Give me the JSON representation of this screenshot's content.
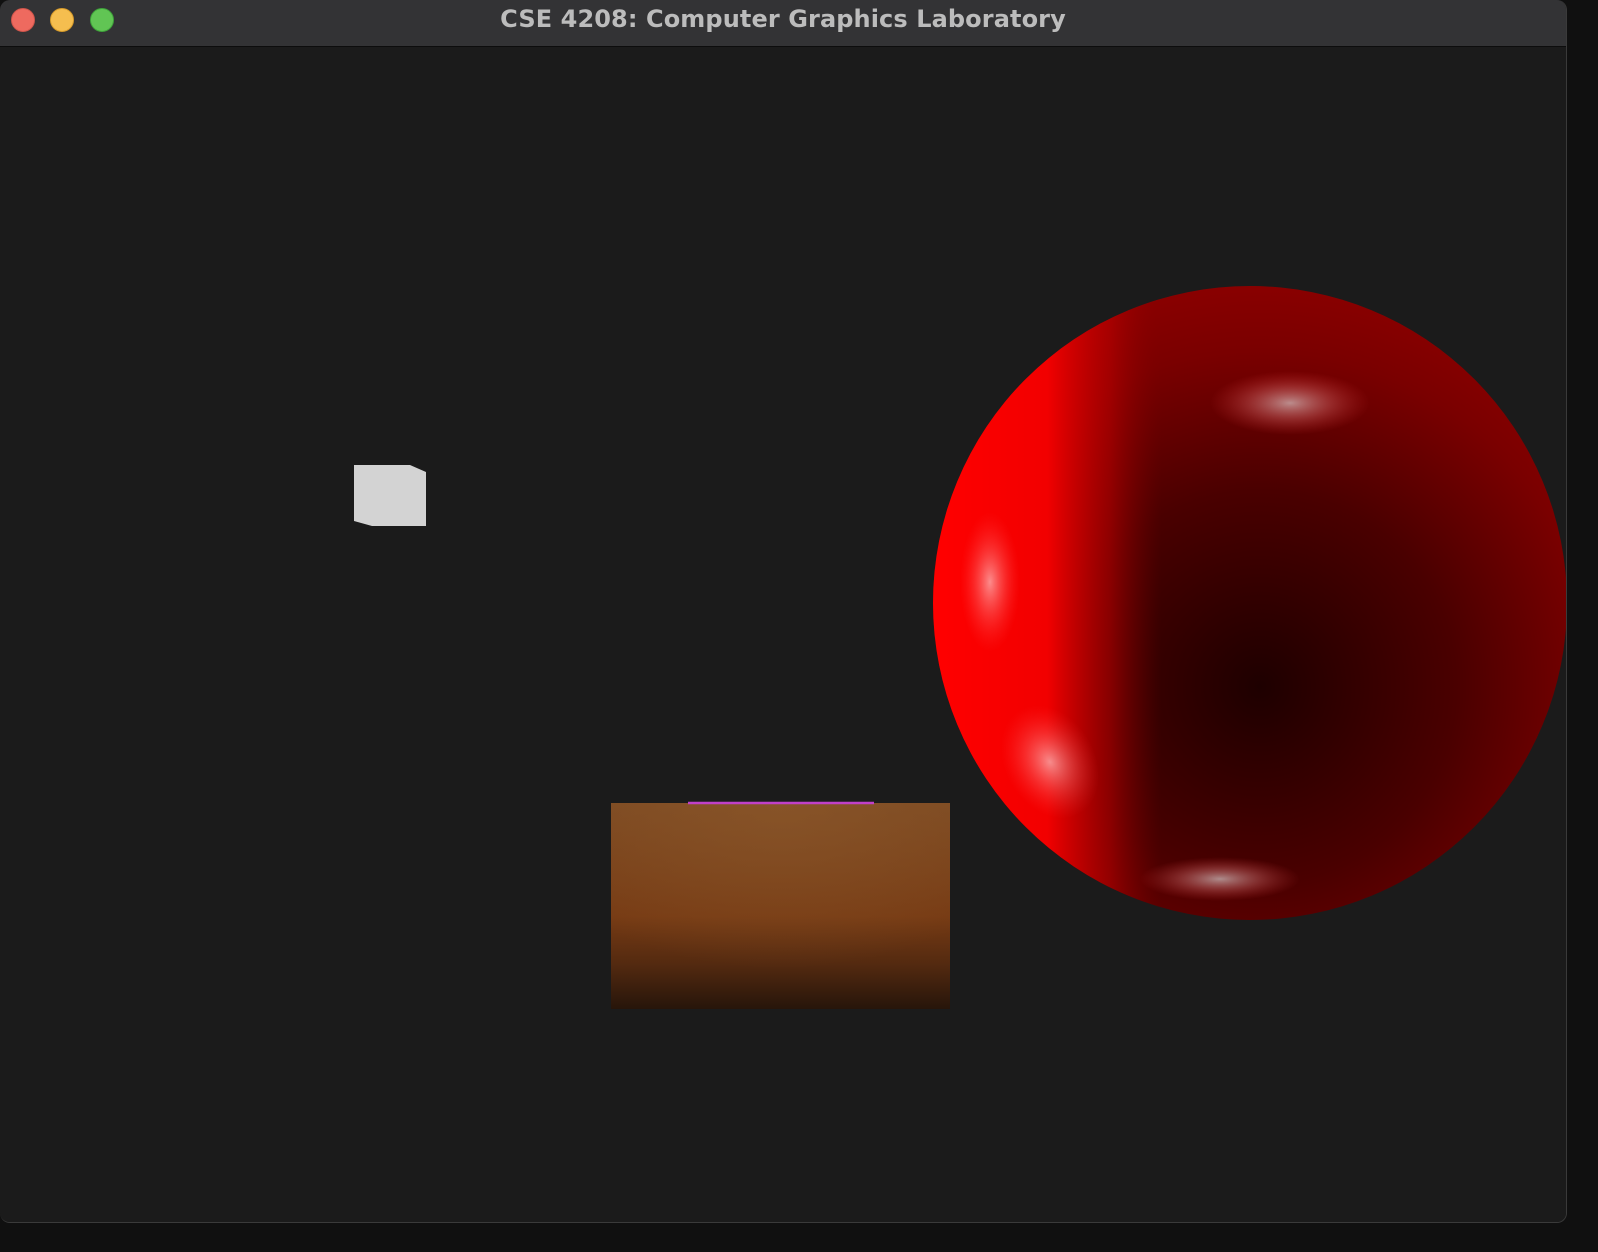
{
  "window": {
    "title": "CSE 4208: Computer Graphics Laboratory",
    "controls": [
      {
        "name": "close",
        "color": "#ee6a5f"
      },
      {
        "name": "minimize",
        "color": "#f5be4f"
      },
      {
        "name": "maximize",
        "color": "#61c554"
      }
    ]
  },
  "scene": {
    "background_color": "#1b1b1b",
    "objects": [
      {
        "name": "white-cube",
        "color": "#d3d3d3"
      },
      {
        "name": "brown-box",
        "color": "#7a4018"
      },
      {
        "name": "magenta-edge",
        "color": "#c040c8"
      },
      {
        "name": "red-sphere",
        "color": "#ff0000"
      }
    ]
  }
}
